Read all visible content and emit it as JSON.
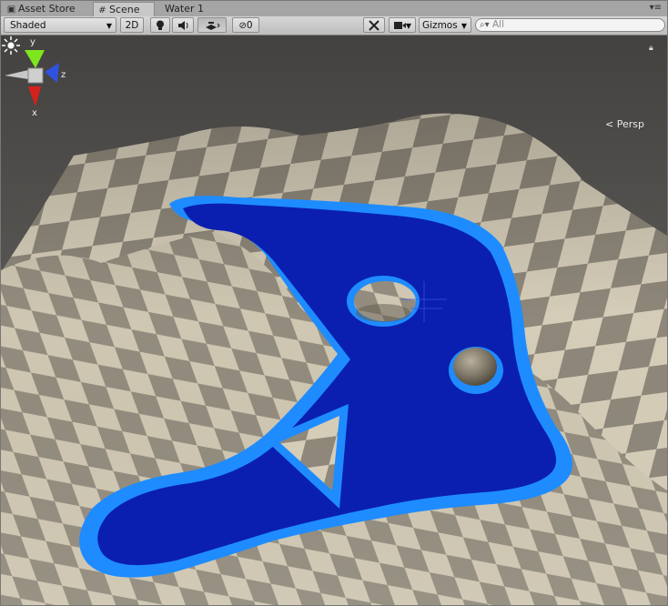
{
  "tabs": [
    {
      "label": "Asset Store",
      "icon": "shopping-icon",
      "active": false
    },
    {
      "label": "Scene",
      "icon": "grid-icon",
      "active": true
    },
    {
      "label": "Water 1",
      "icon": "",
      "active": false
    }
  ],
  "tab_menu_glyph": "▾≡",
  "toolbar": {
    "shading_mode": "Shaded",
    "mode_2d": "2D",
    "light_icon": "lightbulb-icon",
    "audio_icon": "speaker-icon",
    "effects_icon": "effects-icon",
    "hidden_count": "0",
    "tools_icon": "crossed-tools-icon",
    "camera_icon": "camera-icon",
    "gizmos_label": "Gizmos",
    "search_placeholder": "All"
  },
  "viewport": {
    "projection_label": "< Persp",
    "axis_labels": {
      "x": "x",
      "y": "y",
      "z": "z"
    },
    "colors": {
      "water_deep": "#0a1fb0",
      "water_edge": "#1e8cff",
      "terrain_light": "#d8d0bc",
      "terrain_dark": "#8f887a",
      "sky": "#5a5855",
      "axis_x": "#d6201c",
      "axis_y": "#7ee61e",
      "axis_z": "#2f52e0"
    }
  }
}
